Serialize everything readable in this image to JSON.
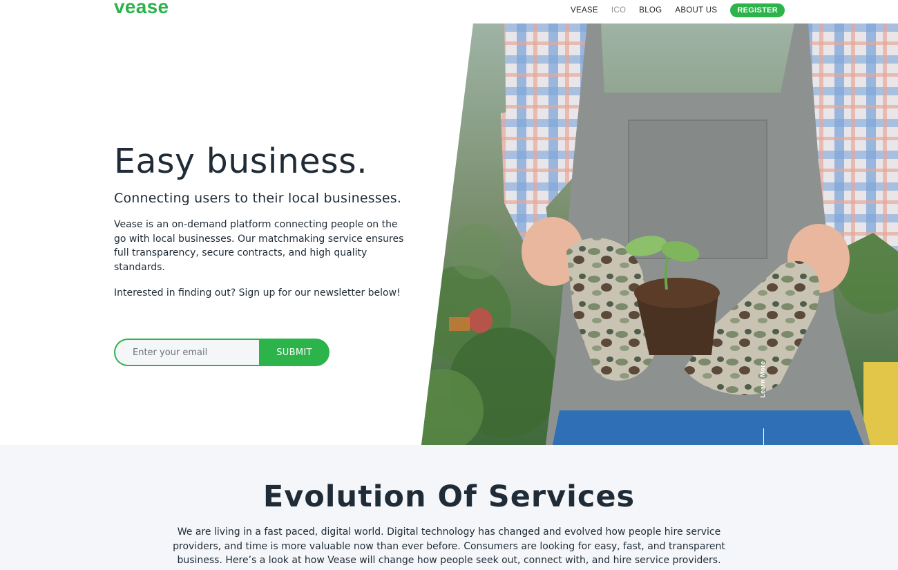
{
  "header": {
    "logo": "vease",
    "nav": [
      "VEASE",
      "ICO",
      "BLOG",
      "ABOUT US"
    ],
    "register": "REGISTER"
  },
  "hero": {
    "title": "Easy business.",
    "subtitle": "Connecting users to their local businesses.",
    "description": "Vease is an on-demand platform connecting people on the go with local businesses. Our matchmaking service ensures full transparency, secure contracts, and high quality standards.",
    "cta_text": "Interested in finding out? Sign up for our newsletter below!",
    "email_placeholder": "Enter your email",
    "submit_label": "SUBMIT",
    "learn_more": "Learn More"
  },
  "section": {
    "title": "Evolution Of Services",
    "description": "We are living in a fast paced, digital world. Digital technology has changed and evolved how people hire service providers, and time is more valuable now than ever before. Consumers are looking for easy, fast, and transparent business. Here’s a look at how Vease will change how people seek out, connect with, and hire service providers."
  },
  "colors": {
    "brand_green": "#2cb34a",
    "text_dark": "#1f2b36",
    "section_bg": "#f4f6f9"
  }
}
